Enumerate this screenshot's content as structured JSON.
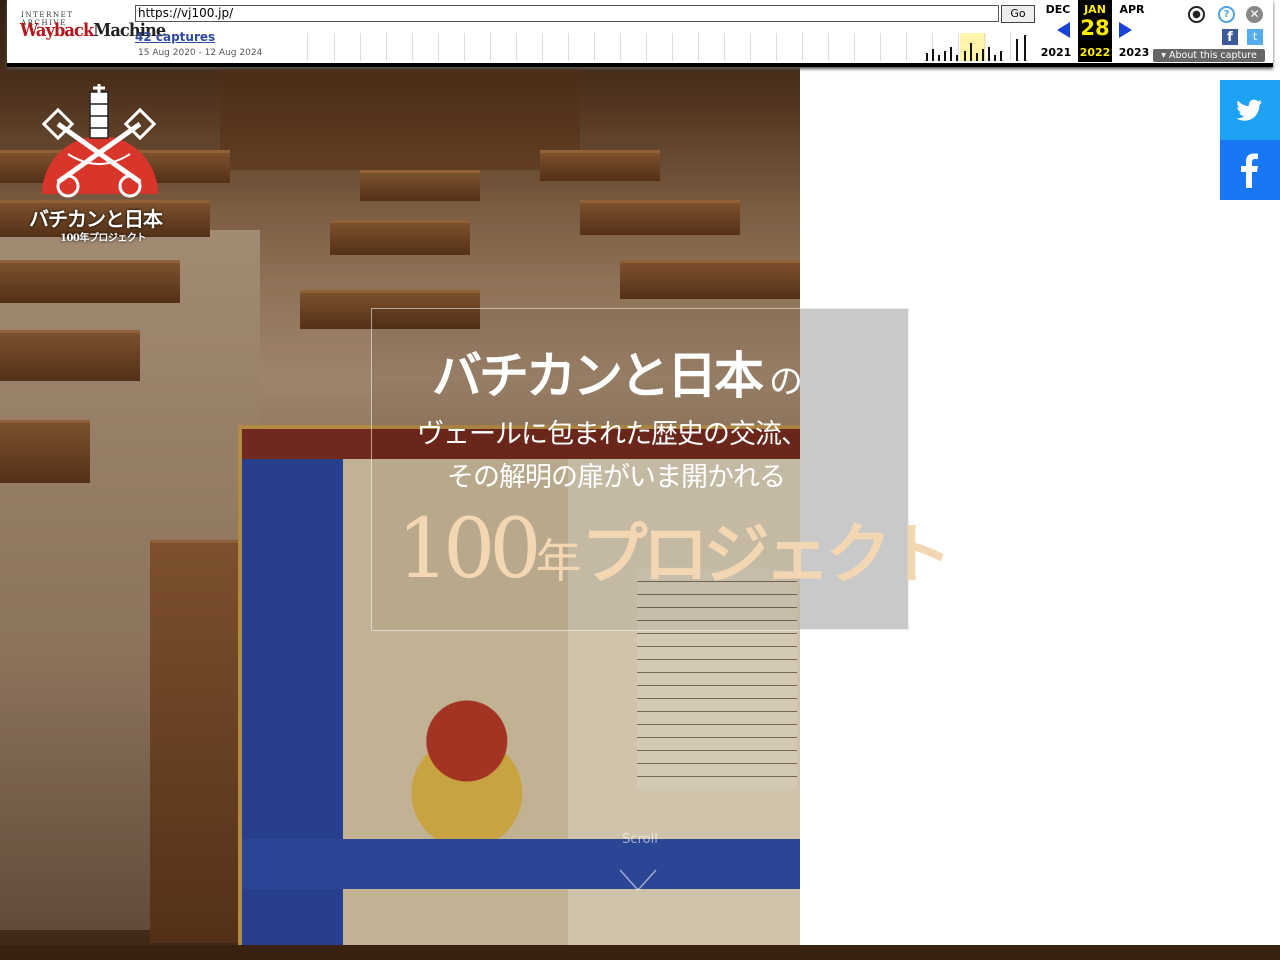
{
  "wayback": {
    "logo_top": "INTERNET ARCHIVE",
    "logo_wayback": "Wayback",
    "logo_machine": "Machine",
    "url": "https://vj100.jp/",
    "go_label": "Go",
    "captures": "42 captures",
    "date_range": "15 Aug 2020 - 12 Aug 2024",
    "prev_month": "DEC",
    "prev_year": "2021",
    "cur_month": "JAN",
    "cur_day": "28",
    "cur_year": "2022",
    "next_month": "APR",
    "next_year": "2023",
    "about_label": "▾ About this capture",
    "facebook_glyph": "f",
    "twitter_glyph": "t",
    "help_glyph": "?",
    "close_glyph": "✕",
    "user_glyph": "●"
  },
  "site": {
    "logo_title": "バチカンと日本",
    "logo_subtitle": "100年プロジェクト",
    "headline_main": "バチカンと日本",
    "headline_no": "の",
    "line2": "ヴェールに包まれた歴史の交流、",
    "line3": "その解明の扉がいま開かれる",
    "line4_num": "100",
    "line4_nen": "年",
    "line4_project": "プロジェクト",
    "scroll_label": "Scroll"
  },
  "social": {
    "twitter_icon": "twitter-icon",
    "facebook_icon": "facebook-icon"
  },
  "colors": {
    "wayback_blue": "#1a43d6",
    "wayback_yellow": "#ffed00",
    "twitter": "#1da1f2",
    "facebook": "#1877f2",
    "logo_red": "#d9362b",
    "project_gold": "#f3d7b2"
  }
}
